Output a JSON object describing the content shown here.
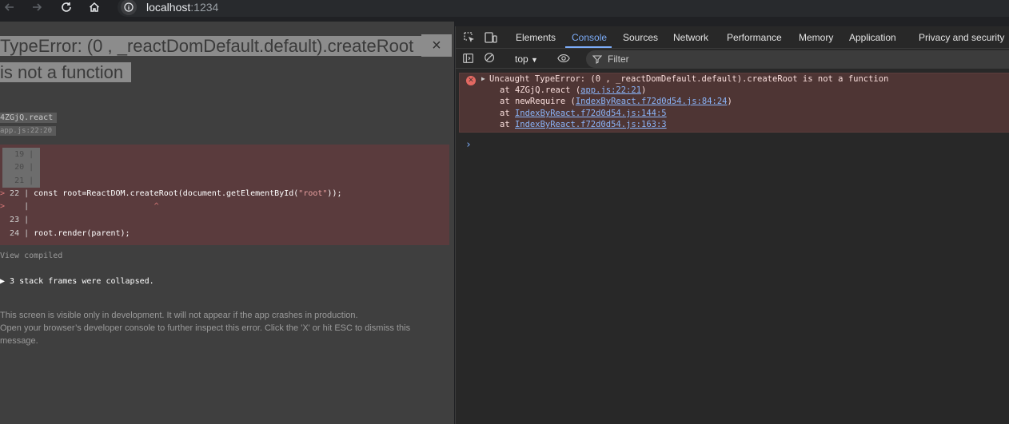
{
  "browser": {
    "url_host": "localhost",
    "url_port": ":1234"
  },
  "overlay": {
    "title": "TypeError: (0 , _reactDomDefault.default).createRoot is not a function",
    "close": "×",
    "frame_name": "4ZGjQ.react",
    "frame_location": "app.js:22:20",
    "code_lines": [
      {
        "num": "19",
        "text": ""
      },
      {
        "num": "20",
        "text": ""
      },
      {
        "num": "21",
        "text": ""
      },
      {
        "num": "22",
        "pre": "const root=ReactDOM.createRoot(document.getElementById(",
        "str": "\"root\"",
        "post": "));"
      },
      {
        "num": "",
        "caret": "^"
      },
      {
        "num": "23",
        "text": ""
      },
      {
        "num": "24",
        "text": "root.render(parent);"
      }
    ],
    "view_compiled": "View compiled",
    "collapsed": "▶ 3 stack frames were collapsed.",
    "footer_line1": "This screen is visible only in development. It will not appear if the app crashes in production.",
    "footer_line2": "Open your browser’s developer console to further inspect this error.  Click the 'X' or hit ESC to dismiss this message."
  },
  "devtools": {
    "tabs": [
      "Elements",
      "Console",
      "Sources",
      "Network",
      "Performance",
      "Memory",
      "Application",
      "Privacy and security"
    ],
    "active_tab": "Console",
    "context": "top",
    "filter_placeholder": "Filter",
    "error": {
      "message": "Uncaught TypeError: (0 , _reactDomDefault.default).createRoot is not a function",
      "stack": [
        {
          "prefix": "at 4ZGjQ.react (",
          "link": "app.js:22:21",
          "suffix": ")"
        },
        {
          "prefix": "at newRequire (",
          "link": "IndexByReact.f72d0d54.js:84:24",
          "suffix": ")"
        },
        {
          "prefix": "at ",
          "link": "IndexByReact.f72d0d54.js:144:5",
          "suffix": ""
        },
        {
          "prefix": "at ",
          "link": "IndexByReact.f72d0d54.js:163:3",
          "suffix": ""
        }
      ]
    },
    "prompt": "›"
  },
  "colors": {
    "accent": "#7cacf8",
    "error_bg": "#4e3534",
    "overlay_bg": "#3f3f3f",
    "code_bg": "#5a3b3d"
  }
}
